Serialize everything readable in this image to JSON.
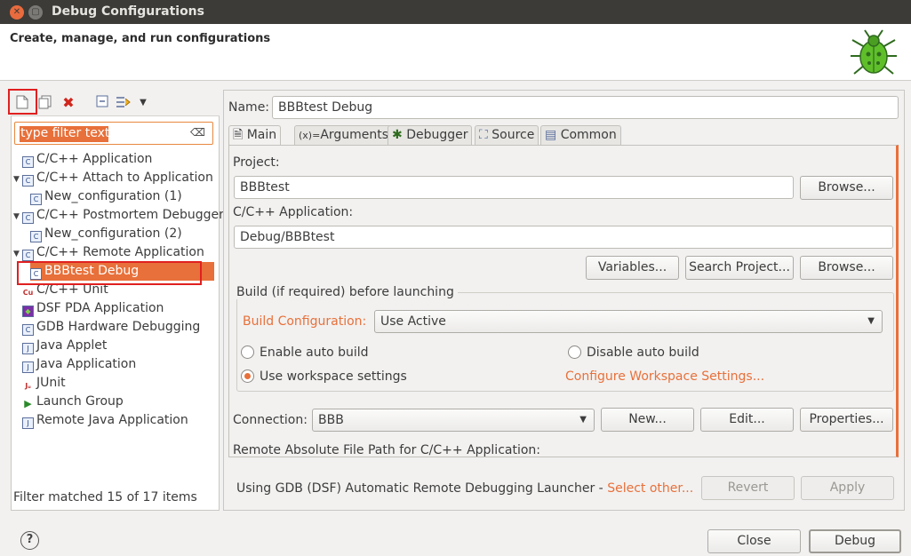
{
  "window": {
    "title": "Debug Configurations"
  },
  "banner": {
    "heading": "Create, manage, and run configurations"
  },
  "filter": {
    "placeholder": "type filter text"
  },
  "tree": [
    {
      "label": "C/C++ Application",
      "indent": 0,
      "expanded": false,
      "icon": "c-icon"
    },
    {
      "label": "C/C++ Attach to Application",
      "indent": 0,
      "expanded": true,
      "icon": "c-icon"
    },
    {
      "label": "New_configuration (1)",
      "indent": 1,
      "icon": "c-icon"
    },
    {
      "label": "C/C++ Postmortem Debugger",
      "indent": 0,
      "expanded": true,
      "icon": "c-icon"
    },
    {
      "label": "New_configuration (2)",
      "indent": 1,
      "icon": "c-icon"
    },
    {
      "label": "C/C++ Remote Application",
      "indent": 0,
      "expanded": true,
      "icon": "c-icon"
    },
    {
      "label": "BBBtest Debug",
      "indent": 1,
      "icon": "c-icon",
      "selected": true
    },
    {
      "label": "C/C++ Unit",
      "indent": 0,
      "icon": "cu-icon"
    },
    {
      "label": "DSF PDA Application",
      "indent": 0,
      "icon": "dsf-icon"
    },
    {
      "label": "GDB Hardware Debugging",
      "indent": 0,
      "icon": "c-icon"
    },
    {
      "label": "Java Applet",
      "indent": 0,
      "icon": "java-applet-icon"
    },
    {
      "label": "Java Application",
      "indent": 0,
      "icon": "java-app-icon"
    },
    {
      "label": "JUnit",
      "indent": 0,
      "icon": "junit-icon"
    },
    {
      "label": "Launch Group",
      "indent": 0,
      "icon": "launch-group-icon"
    },
    {
      "label": "Remote Java Application",
      "indent": 0,
      "icon": "remote-java-icon"
    }
  ],
  "filter_status": "Filter matched 15 of 17 items",
  "form": {
    "name_label": "Name:",
    "name_value": "BBBtest Debug",
    "tabs": [
      "Main",
      "Arguments",
      "Debugger",
      "Source",
      "Common"
    ],
    "project_label": "Project:",
    "project_value": "BBBtest",
    "browse_label": "Browse...",
    "app_label": "C/C++ Application:",
    "app_value": "Debug/BBBtest",
    "variables_label": "Variables...",
    "search_project_label": "Search Project...",
    "build_group_label": "Build (if required) before launching",
    "build_config_label": "Build Configuration:",
    "build_config_value": "Use Active",
    "enable_auto_build": "Enable auto build",
    "disable_auto_build": "Disable auto build",
    "use_workspace_settings": "Use workspace settings",
    "configure_workspace_link": "Configure Workspace Settings...",
    "connection_label": "Connection:",
    "connection_value": "BBB",
    "new_label": "New...",
    "edit_label": "Edit...",
    "properties_label": "Properties...",
    "remote_path_label": "Remote Absolute File Path for C/C++ Application:"
  },
  "launcher": {
    "text": "Using GDB (DSF) Automatic Remote Debugging Launcher - ",
    "link": "Select other..."
  },
  "buttons": {
    "revert": "Revert",
    "apply": "Apply",
    "close": "Close",
    "debug": "Debug",
    "help": "?"
  },
  "colors": {
    "accent": "#e8703a",
    "highlight": "#e02020"
  }
}
